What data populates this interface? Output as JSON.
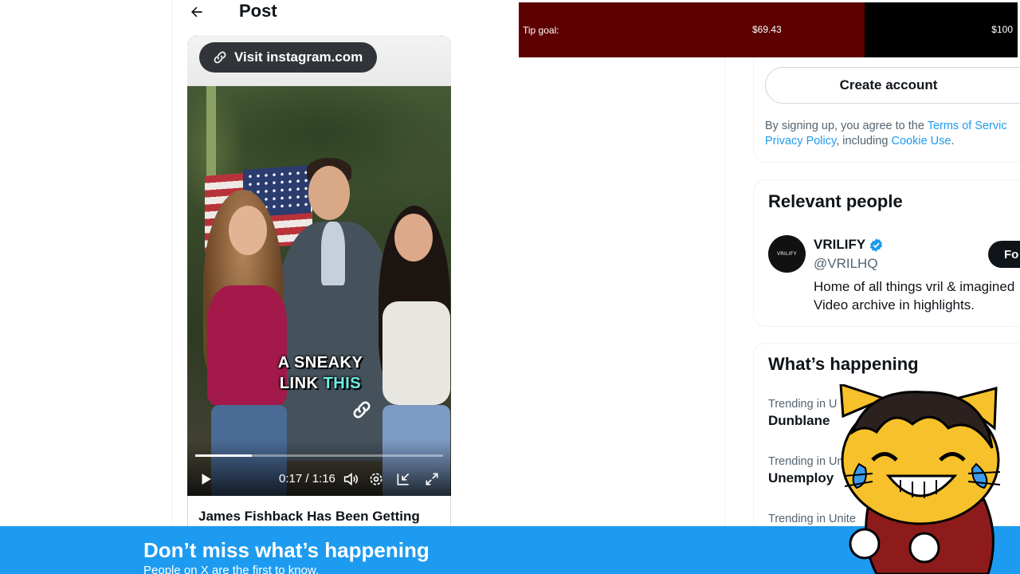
{
  "header": {
    "title": "Post"
  },
  "video": {
    "visit_label": "Visit instagram.com",
    "caption_line1": "A SNEAKY",
    "caption_line2_white": "LINK",
    "caption_line2_highlight": "THIS",
    "time_display": "0:17 / 1:16",
    "progress_fraction": 0.227
  },
  "post": {
    "title": "James Fishback Has Been Getting"
  },
  "tip": {
    "label": "Tip goal:",
    "current": "$69.43",
    "target": "$100",
    "fraction": 0.694
  },
  "signup": {
    "create_label": "Create account",
    "terms_prefix": "By signing up, you agree to the ",
    "terms_link": "Terms of Servic",
    "privacy_link": "Privacy Policy",
    "including": ", including ",
    "cookie_link": "Cookie Use",
    "period": "."
  },
  "relevant": {
    "title": "Relevant people",
    "avatar_text": "VRILIFY",
    "name": "VRILIFY",
    "handle": "@VRILHQ",
    "bio_line1": "Home of all things vril & imagined",
    "bio_line2": "Video archive in highlights.",
    "follow_label": "Fo"
  },
  "happening": {
    "title": "What’s happening",
    "trends": [
      {
        "meta": "Trending in U",
        "name": "Dunblane"
      },
      {
        "meta": "Trending in Un",
        "name": "Unemploy"
      },
      {
        "meta": "Trending in Unite",
        "name": ""
      }
    ]
  },
  "banner": {
    "title": "Don’t miss what’s happening",
    "subtitle": "People on X are the first to know."
  },
  "colors": {
    "accent": "#1d9bf0",
    "tip_fill": "#5c0000",
    "verified": "#1d9bf0"
  }
}
